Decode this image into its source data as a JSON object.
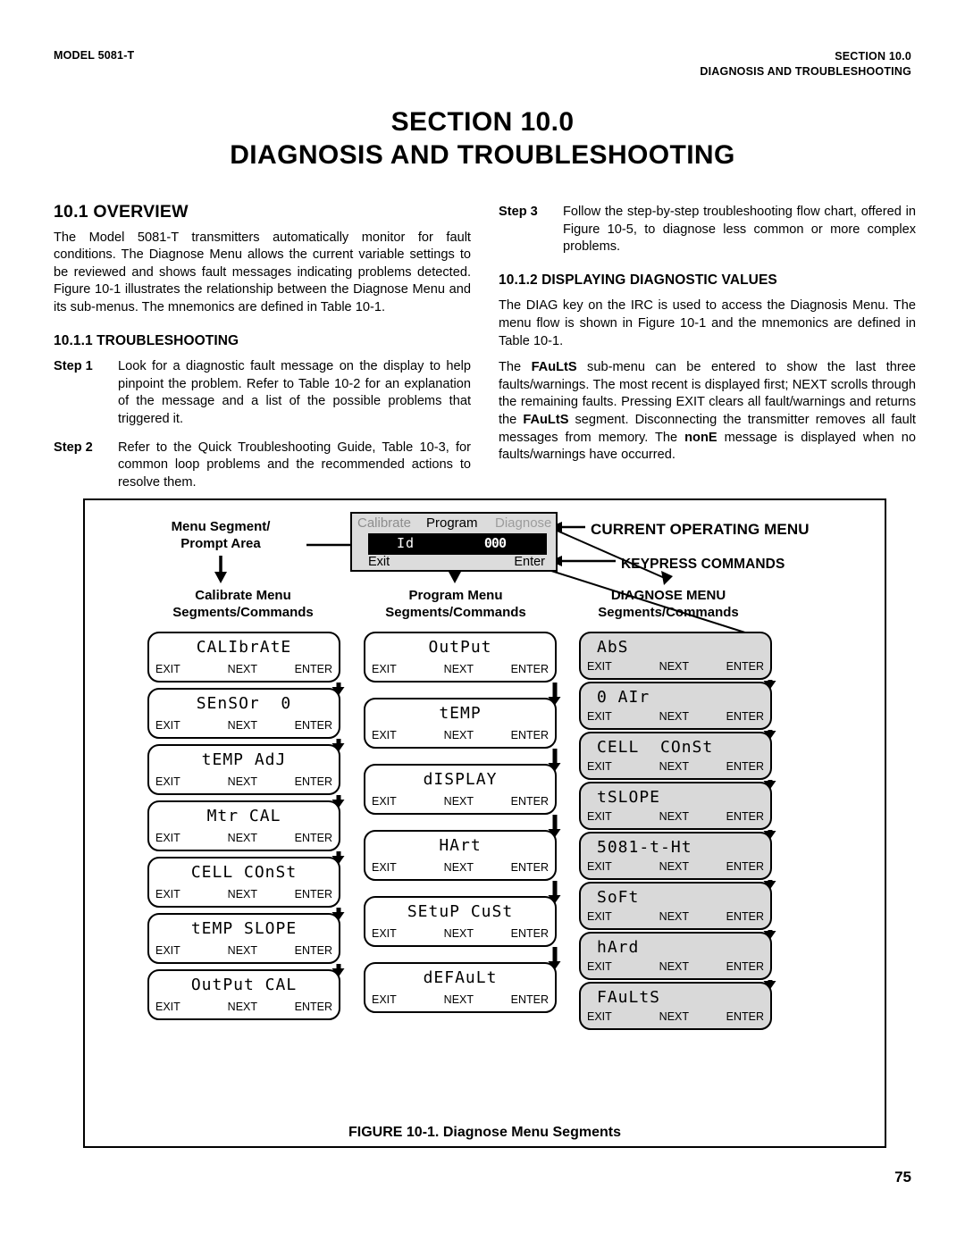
{
  "running_head": {
    "left": "MODEL 5081-T",
    "right_line1": "SECTION 10.0",
    "right_line2": "DIAGNOSIS AND TROUBLESHOOTING"
  },
  "section_title": {
    "line1": "SECTION 10.0",
    "line2": "DIAGNOSIS AND TROUBLESHOOTING"
  },
  "left_column": {
    "heading": "10.1 OVERVIEW",
    "overview_paragraph": "The Model 5081-T transmitters automatically monitor for fault conditions. The Diagnose Menu allows the current variable settings to be reviewed and shows fault messages indicating problems detected. Figure 10-1 illustrates the relationship between the Diagnose Menu and its sub-menus. The mnemonics are defined in Table 10-1.",
    "subheading": "10.1.1 TROUBLESHOOTING",
    "step1_label": "Step 1",
    "step1_text": "Look for a diagnostic fault message on the display to help pinpoint the problem. Refer to Table 10-2 for an explanation of the message and a list of the possible problems that triggered it.",
    "step2_label": "Step 2",
    "step2_text": "Refer to the Quick Troubleshooting Guide, Table 10-3, for common loop problems and the recommended actions to resolve them."
  },
  "right_column": {
    "step3_label": "Step 3",
    "step3_text": "Follow the step-by-step troubleshooting flow chart, offered in Figure 10-5, to diagnose less common or more complex problems.",
    "subheading": "10.1.2 DISPLAYING DIAGNOSTIC VALUES",
    "paragraph1": "The DIAG key on the IRC is used to access the Diagnosis Menu. The menu flow is shown in Figure 10-1 and the mnemonics are defined in Table 10-1.",
    "paragraph2_part1": "The ",
    "paragraph2_bold1": "FAuLtS",
    "paragraph2_part2": " sub-menu can be entered to show the last three faults/warnings. The most recent is displayed first; NEXT scrolls through the remaining faults. Pressing EXIT clears all fault/warnings and returns the ",
    "paragraph2_bold2": "FAuLtS",
    "paragraph2_part3": " segment. Disconnecting the transmitter removes all fault messages from memory. The ",
    "paragraph2_bold3": "nonE",
    "paragraph2_part4": " message is displayed when no faults/warnings have occurred."
  },
  "figure": {
    "caption": "FIGURE 10-1.  Diagnose Menu Segments",
    "device": {
      "menu_calibrate": "Calibrate",
      "menu_program": "Program",
      "menu_diagnose": "Diagnose",
      "lcd_left": "Id",
      "lcd_right": "000",
      "key_exit": "Exit",
      "key_enter": "Enter",
      "active_menu_color": "#000000",
      "inactive_menu_color": "#8d8d8d",
      "panel_color": "#dcdcdc",
      "lcd_color": "#000000"
    },
    "callouts": {
      "menu_segment_line1": "Menu Segment/",
      "menu_segment_line2": "Prompt Area",
      "current_operating_menu": "CURRENT OPERATING MENU",
      "keypress_commands": "KEYPRESS COMMANDS"
    },
    "column_headings": [
      {
        "line1": "Calibrate Menu",
        "line2": "Segments/Commands"
      },
      {
        "line1": "Program Menu",
        "line2": "Segments/Commands"
      },
      {
        "line1": "DIAGNOSE MENU",
        "line2": "Segments/Commands"
      }
    ],
    "commands": {
      "exit": "EXIT",
      "next": "NEXT",
      "enter": "ENTER"
    },
    "calibrate_menu_items": [
      "CALIbrAtE",
      "SEnSOr  0",
      "tEMP AdJ",
      "Mtr CAL",
      "CELL COnSt",
      "tEMP SLOPE",
      "OutPut CAL"
    ],
    "program_menu_items": [
      "OutPut",
      "tEMP",
      "dISPLAY",
      "HArt",
      "SEtuP CuSt",
      "dEFAuLt"
    ],
    "diagnose_menu_items": [
      "AbS",
      "0 AIr",
      "CELL  COnSt",
      "tSLOPE",
      "5081-t-Ht",
      "SoFt",
      "hArd",
      "FAuLtS"
    ],
    "diagnose_box_fill": "#d9d9d9"
  },
  "page_number": "75"
}
